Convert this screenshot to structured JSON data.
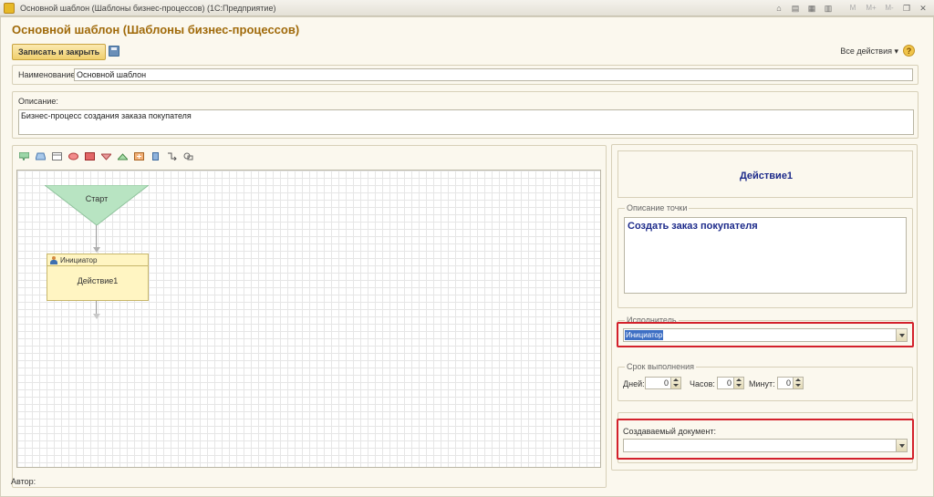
{
  "window": {
    "title": "Основной шаблон (Шаблоны бизнес-процессов)  (1С:Предприятие)",
    "form_title": "Основной шаблон (Шаблоны бизнес-процессов)",
    "titlebar_buttons": [
      "M",
      "M+",
      "M-"
    ]
  },
  "toolbar": {
    "save_close_label": "Записать и закрыть",
    "all_actions_label": "Все действия ▾",
    "help_label": "?"
  },
  "fields": {
    "name_label": "Наименование:",
    "name_value": "Основной шаблон",
    "description_label": "Описание:",
    "description_value": "Бизнес-процесс создания заказа покупателя",
    "author_label": "Автор:"
  },
  "diagram": {
    "start_label": "Старт",
    "action_role": "Инициатор",
    "action_name": "Действие1",
    "palette_icons": [
      "activity-icon",
      "start-icon",
      "condition-icon",
      "end-icon",
      "decision-icon",
      "split-icon",
      "merge-icon",
      "processing-icon",
      "subprocess-icon",
      "column-icon",
      "connector-icon",
      "decoration-icon"
    ]
  },
  "properties": {
    "point_title": "Действие1",
    "point_description_legend": "Описание точки",
    "point_description_value": "Создать заказ покупателя",
    "executor_legend": "Исполнитель",
    "executor_value": "Инициатор",
    "deadline_legend": "Срок выполнения",
    "days_label": "Дней:",
    "days_value": "0",
    "hours_label": "Часов:",
    "hours_value": "0",
    "minutes_label": "Минут:",
    "minutes_value": "0",
    "created_doc_label": "Создаваемый документ:",
    "created_doc_value": ""
  },
  "colors": {
    "title_accent": "#a06a0a",
    "highlight_frame": "#d3212b",
    "point_title": "#1c2a8a",
    "start_fill": "#b8e4c2",
    "action_fill": "#fff5c2"
  }
}
